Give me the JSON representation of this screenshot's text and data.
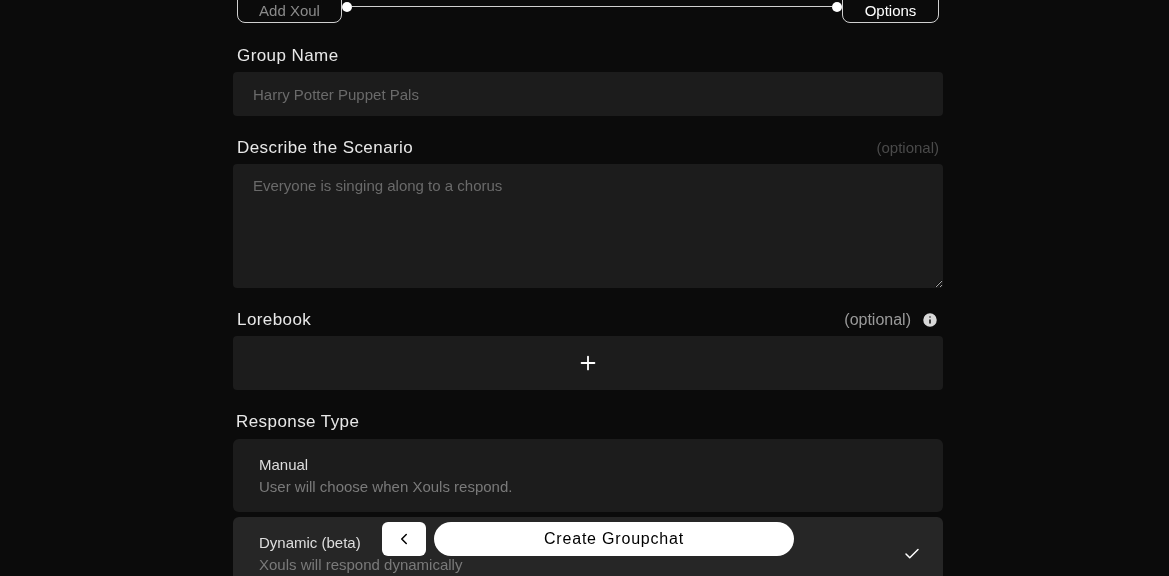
{
  "stepper": {
    "steps": [
      {
        "label": "Add Xoul",
        "selected": false
      },
      {
        "label": "Options",
        "selected": true
      }
    ]
  },
  "group_name": {
    "label": "Group Name",
    "placeholder": "Harry Potter Puppet Pals"
  },
  "scenario": {
    "label": "Describe the Scenario",
    "hint": "(optional)",
    "placeholder": "Everyone is singing along to a chorus"
  },
  "lorebook": {
    "label": "Lorebook",
    "hint": "(optional)"
  },
  "response_type": {
    "label": "Response Type",
    "options": [
      {
        "title": "Manual",
        "description": "User will choose when Xouls respond.",
        "selected": false
      },
      {
        "title": "Dynamic (beta)",
        "description": "Xouls will respond dynamically",
        "selected": true
      }
    ]
  },
  "footer": {
    "create_button": "Create Groupchat"
  }
}
